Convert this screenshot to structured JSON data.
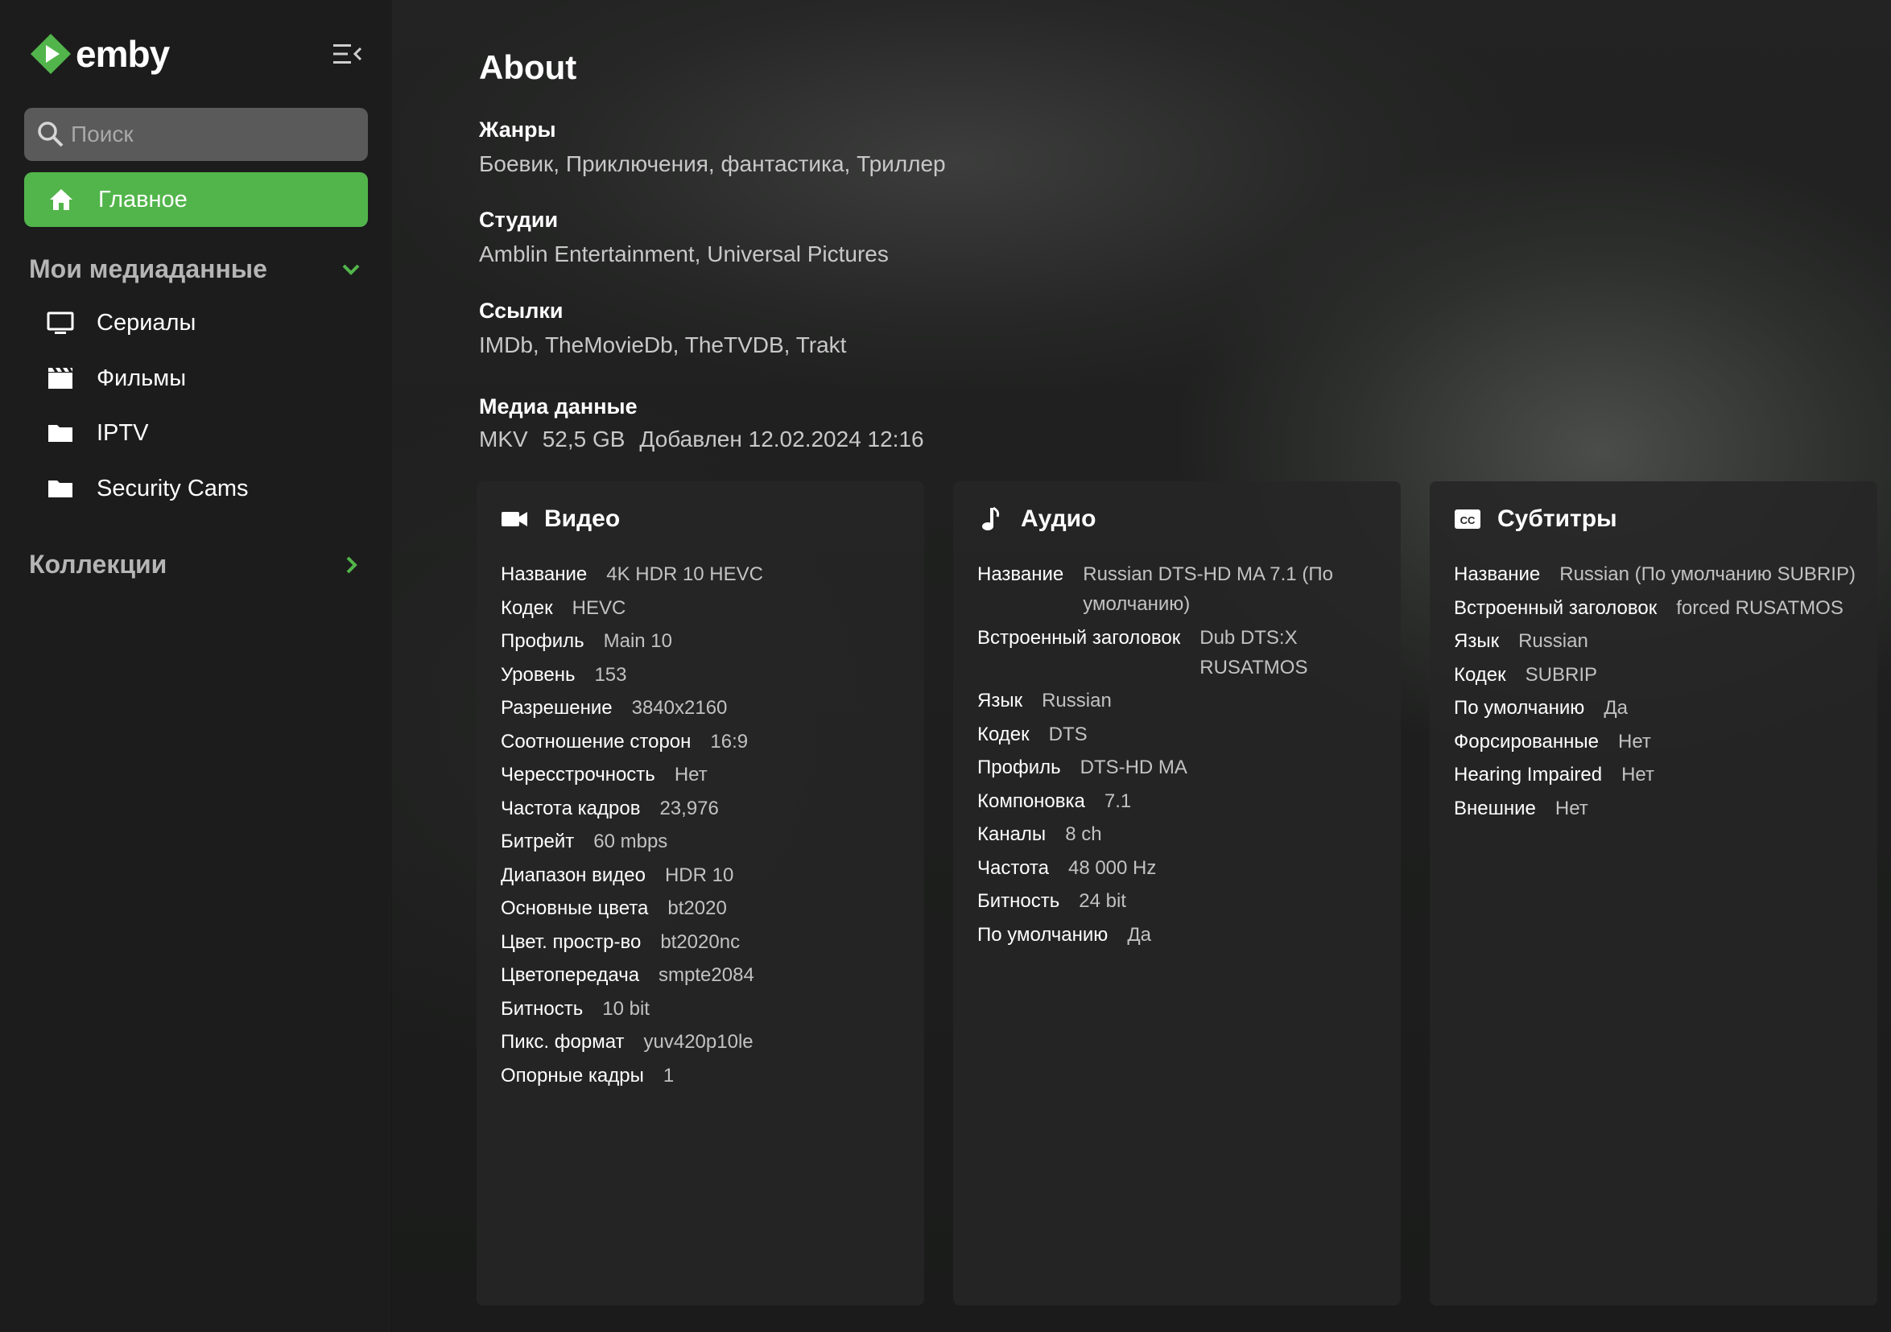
{
  "brand": {
    "name": "emby"
  },
  "search": {
    "placeholder": "Поиск"
  },
  "nav": {
    "home_label": "Главное",
    "media_section": "Мои медиаданные",
    "items": [
      {
        "label": "Сериалы",
        "icon": "tv-icon"
      },
      {
        "label": "Фильмы",
        "icon": "movie-icon"
      },
      {
        "label": "IPTV",
        "icon": "folder-icon"
      },
      {
        "label": "Security Cams",
        "icon": "folder-icon"
      }
    ],
    "collections_section": "Коллекции"
  },
  "about": {
    "title": "About",
    "genres_label": "Жанры",
    "genres": "Боевик, Приключения, фантастика, Триллер",
    "studios_label": "Студии",
    "studios": "Amblin Entertainment, Universal Pictures",
    "links_label": "Ссылки",
    "links": "IMDb, TheMovieDb, TheTVDB, Trakt",
    "media_label": "Медиа данные",
    "media": {
      "container": "MKV",
      "size": "52,5 GB",
      "added": "Добавлен 12.02.2024 12:16"
    }
  },
  "video": {
    "title": "Видео",
    "rows": [
      {
        "k": "Название",
        "v": "4K HDR 10 HEVC"
      },
      {
        "k": "Кодек",
        "v": "HEVC"
      },
      {
        "k": "Профиль",
        "v": "Main 10"
      },
      {
        "k": "Уровень",
        "v": "153"
      },
      {
        "k": "Разрешение",
        "v": "3840x2160"
      },
      {
        "k": "Соотношение сторон",
        "v": "16:9"
      },
      {
        "k": "Чересстрочность",
        "v": "Нет"
      },
      {
        "k": "Частота кадров",
        "v": "23,976"
      },
      {
        "k": "Битрейт",
        "v": "60 mbps"
      },
      {
        "k": "Диапазон видео",
        "v": "HDR 10"
      },
      {
        "k": "Основные цвета",
        "v": "bt2020"
      },
      {
        "k": "Цвет. простр-во",
        "v": "bt2020nc"
      },
      {
        "k": "Цветопередача",
        "v": "smpte2084"
      },
      {
        "k": "Битность",
        "v": "10 bit"
      },
      {
        "k": "Пикс. формат",
        "v": "yuv420p10le"
      },
      {
        "k": "Опорные кадры",
        "v": "1"
      }
    ]
  },
  "audio": {
    "title": "Аудио",
    "rows": [
      {
        "k": "Название",
        "v": "Russian DTS-HD MA 7.1 (По умолчанию)"
      },
      {
        "k": "Встроенный заголовок",
        "v": "Dub DTS:X RUSATMOS"
      },
      {
        "k": "Язык",
        "v": "Russian"
      },
      {
        "k": "Кодек",
        "v": "DTS"
      },
      {
        "k": "Профиль",
        "v": "DTS-HD MA"
      },
      {
        "k": "Компоновка",
        "v": "7.1"
      },
      {
        "k": "Каналы",
        "v": "8 ch"
      },
      {
        "k": "Частота",
        "v": "48 000 Hz"
      },
      {
        "k": "Битность",
        "v": "24 bit"
      },
      {
        "k": "По умолчанию",
        "v": "Да"
      }
    ]
  },
  "subtitles": {
    "title": "Субтитры",
    "rows": [
      {
        "k": "Название",
        "v": "Russian (По умолчанию SUBRIP)"
      },
      {
        "k": "Встроенный заголовок",
        "v": "forced RUSATMOS"
      },
      {
        "k": "Язык",
        "v": "Russian"
      },
      {
        "k": "Кодек",
        "v": "SUBRIP"
      },
      {
        "k": "По умолчанию",
        "v": "Да"
      },
      {
        "k": "Форсированные",
        "v": "Нет"
      },
      {
        "k": "Hearing Impaired",
        "v": "Нет"
      },
      {
        "k": "Внешние",
        "v": "Нет"
      }
    ]
  },
  "colors": {
    "accent": "#52b54b",
    "sidebar": "#1c1c1c",
    "card": "#262626"
  }
}
